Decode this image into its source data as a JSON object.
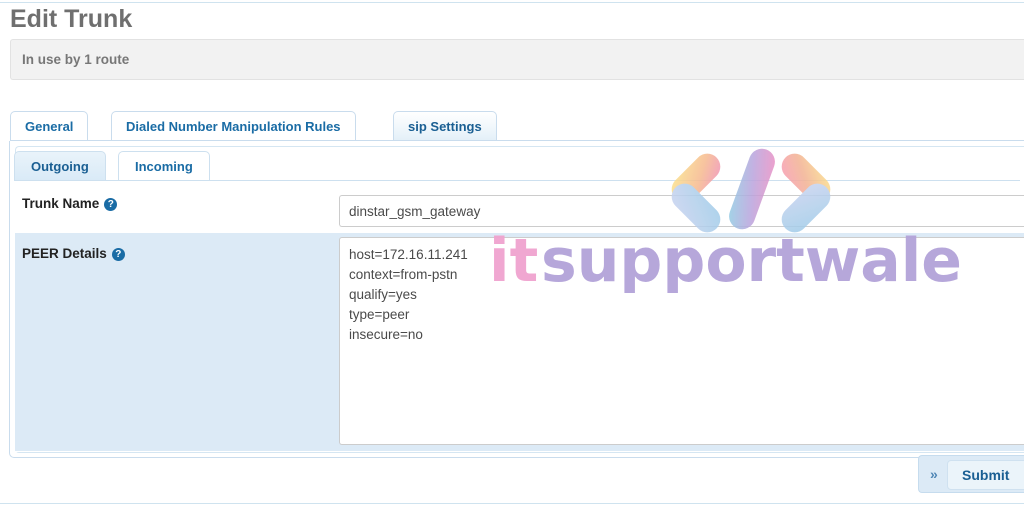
{
  "page": {
    "title": "Edit Trunk",
    "alert": "In use by 1 route"
  },
  "tabs": {
    "main": [
      {
        "label": "General",
        "active": false
      },
      {
        "label": "Dialed Number Manipulation Rules",
        "active": false
      },
      {
        "label": "sip Settings",
        "active": true
      }
    ],
    "sub": [
      {
        "label": "Outgoing",
        "active": true
      },
      {
        "label": "Incoming",
        "active": false
      }
    ]
  },
  "form": {
    "trunk_name": {
      "label": "Trunk Name",
      "help": "?",
      "value": "dinstar_gsm_gateway",
      "placeholder": ""
    },
    "peer_details": {
      "label": "PEER Details",
      "help": "?",
      "value": "host=172.16.11.241\ncontext=from-pstn\nqualify=yes\ntype=peer\ninsecure=no",
      "placeholder": ""
    }
  },
  "footer": {
    "chevron": "»",
    "submit_label": "Submit"
  },
  "watermark": {
    "brand_part1": "it",
    "brand_part2": "supportwale",
    "logo": "code-brackets-logo",
    "color_pink": "#f2a0cd",
    "color_purple": "#b3a3d9",
    "color_blue": "#a8cdea",
    "color_orange": "#f7c98a"
  },
  "colors": {
    "accent": "#1a6ca5",
    "row_highlight": "#dceaf6",
    "panel_border": "#c9dced",
    "title_gray": "#6f6f6f"
  }
}
